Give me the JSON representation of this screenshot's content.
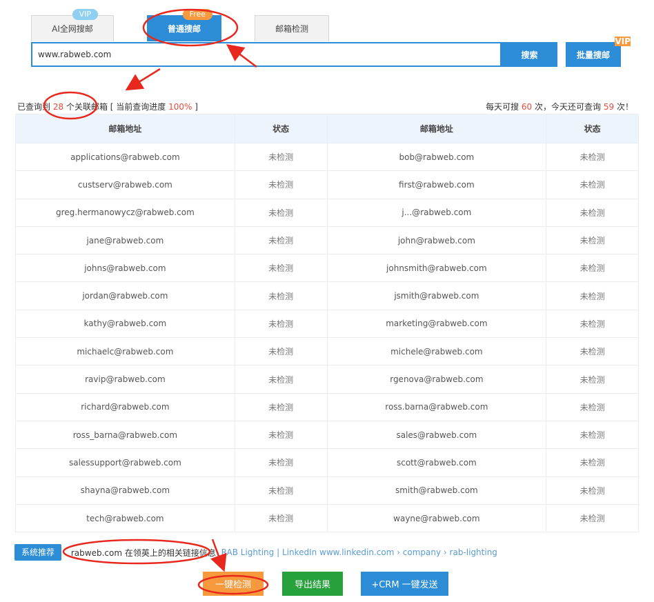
{
  "tabs": [
    {
      "label": "AI全网搜邮",
      "badge": "VIP"
    },
    {
      "label": "普通搜邮",
      "badge": "Free"
    },
    {
      "label": "邮箱检测",
      "badge": ""
    }
  ],
  "search": {
    "value": "www.rabweb.com",
    "button_label": "搜索",
    "batch_label": "批量搜邮",
    "batch_badge": "VIP"
  },
  "status": {
    "prefix": "已查询到",
    "count": "28",
    "suffix": "个关联邮箱 [ 当前查询进度",
    "progress": "100%",
    "close": "]"
  },
  "quota": {
    "prefix": "每天可搜",
    "daily": "60",
    "middle": "次，今天还可查询",
    "remaining": "59",
    "suffix": "次！"
  },
  "table": {
    "headers": [
      "邮箱地址",
      "状态",
      "邮箱地址",
      "状态"
    ],
    "rows": [
      [
        "applications@rabweb.com",
        "未检测",
        "bob@rabweb.com",
        "未检测"
      ],
      [
        "custserv@rabweb.com",
        "未检测",
        "first@rabweb.com",
        "未检测"
      ],
      [
        "greg.hermanowycz@rabweb.com",
        "未检测",
        "j...@rabweb.com",
        "未检测"
      ],
      [
        "jane@rabweb.com",
        "未检测",
        "john@rabweb.com",
        "未检测"
      ],
      [
        "johns@rabweb.com",
        "未检测",
        "johnsmith@rabweb.com",
        "未检测"
      ],
      [
        "jordan@rabweb.com",
        "未检测",
        "jsmith@rabweb.com",
        "未检测"
      ],
      [
        "kathy@rabweb.com",
        "未检测",
        "marketing@rabweb.com",
        "未检测"
      ],
      [
        "michaelc@rabweb.com",
        "未检测",
        "michele@rabweb.com",
        "未检测"
      ],
      [
        "ravip@rabweb.com",
        "未检测",
        "rgenova@rabweb.com",
        "未检测"
      ],
      [
        "richard@rabweb.com",
        "未检测",
        "ross.barna@rabweb.com",
        "未检测"
      ],
      [
        "ross_barna@rabweb.com",
        "未检测",
        "sales@rabweb.com",
        "未检测"
      ],
      [
        "salessupport@rabweb.com",
        "未检测",
        "scott@rabweb.com",
        "未检测"
      ],
      [
        "shayna@rabweb.com",
        "未检测",
        "smith@rabweb.com",
        "未检测"
      ],
      [
        "tech@rabweb.com",
        "未检测",
        "wayne@rabweb.com",
        "未检测"
      ]
    ]
  },
  "recommend": {
    "badge": "系统推荐",
    "text": "rabweb.com 在领英上的相关链接信息",
    "link": "RAB Lighting | LinkedIn www.linkedin.com › company › rab-lighting"
  },
  "actions": {
    "check": "一键检测",
    "export": "导出结果",
    "crm": "+CRM 一键发送"
  },
  "colors": {
    "primary": "#2c8dd6",
    "accent_orange": "#f79a3e",
    "green": "#27a13c",
    "highlight_red": "#e64a3b",
    "annotation_red": "#e8281c"
  }
}
